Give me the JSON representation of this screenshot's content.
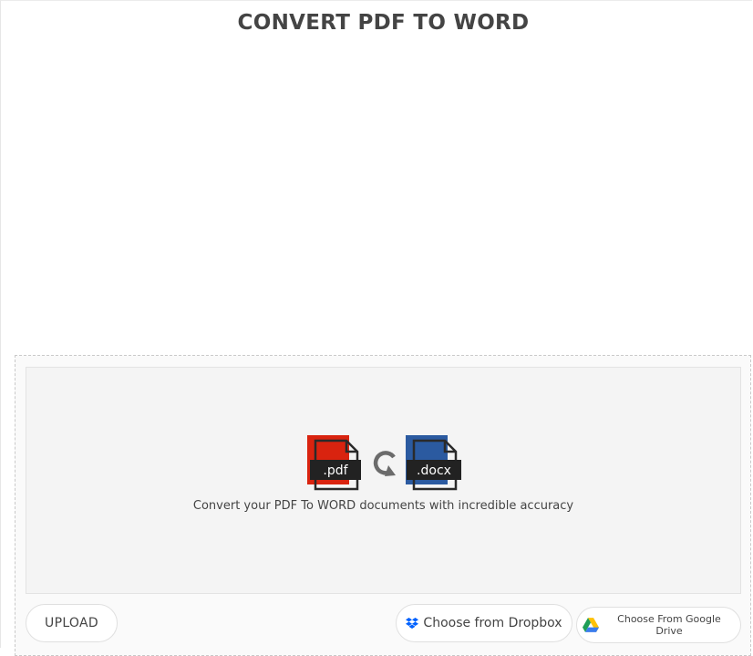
{
  "page": {
    "title": "CONVERT PDF TO WORD",
    "tagline": "Convert your PDF To WORD documents with incredible accuracy"
  },
  "converter": {
    "source_label": ".pdf",
    "target_label": ".docx",
    "source_color": "#d9230f",
    "target_color": "#2b5aa0",
    "icons": {
      "source": "pdf-file-icon",
      "convert": "refresh-icon",
      "target": "docx-file-icon"
    }
  },
  "actions": {
    "upload_label": "UPLOAD",
    "dropbox_label": "Choose from Dropbox",
    "dropbox_icon": "dropbox-icon",
    "dropbox_color": "#0061fe",
    "gdrive_label": "Choose From Google Drive",
    "gdrive_icon": "google-drive-icon"
  }
}
